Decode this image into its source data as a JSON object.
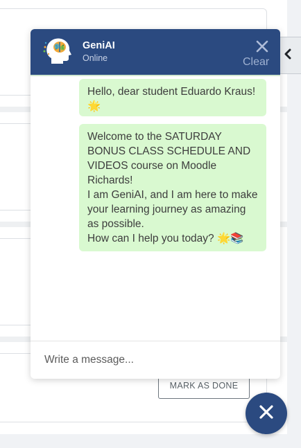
{
  "course_page": {
    "mark_done_label": "MARK AS DONE"
  },
  "chat": {
    "bot_name": "GeniAI",
    "status": "Online",
    "clear_label": "Clear",
    "messages": [
      {
        "from": "bot",
        "text": "Hello, dear student Eduardo Kraus! 🌟"
      },
      {
        "from": "bot",
        "text": "Welcome to the SATURDAY BONUS CLASS SCHEDULE AND VIDEOS course on Moodle Richards!\nI am GeniAI, and I am here to make your learning journey as amazing as possible.\nHow can I help you today? 🌟📚"
      }
    ],
    "input_placeholder": "Write a message...",
    "input_value": ""
  },
  "colors": {
    "header": "#2b4a80",
    "bubble": "#d9f9d0",
    "fab": "#2b4a80"
  },
  "icons": {
    "avatar": "brain-head-icon",
    "close": "close-icon",
    "drawer": "chevron-left-icon",
    "fab": "close-icon"
  }
}
